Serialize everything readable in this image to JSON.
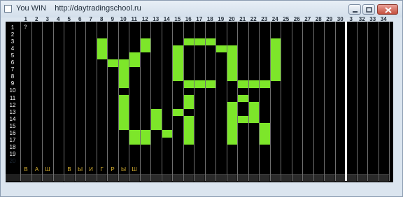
{
  "window": {
    "title": "You WIN    http://daytradingschool.ru",
    "controls": [
      "minimize",
      "maximize",
      "close"
    ]
  },
  "grid": {
    "columns": [
      "1",
      "2",
      "3",
      "4",
      "5",
      "6",
      "7",
      "8",
      "9",
      "10",
      "11",
      "12",
      "13",
      "14",
      "15",
      "16",
      "17",
      "18",
      "19",
      "20",
      "21",
      "22",
      "23",
      "24",
      "25",
      "26",
      "27",
      "28",
      "29",
      "30",
      "3",
      "32",
      "33",
      "34"
    ],
    "rows": [
      "1",
      "2",
      "3",
      "4",
      "5",
      "6",
      "7",
      "8",
      "9",
      "10",
      "11",
      "12",
      "13",
      "14",
      "15",
      "16",
      "17",
      "18",
      "19",
      "20"
    ],
    "row1_col1_text": "?",
    "row19_letters": [
      {
        "col": 1,
        "text": "В"
      },
      {
        "col": 2,
        "text": "А"
      },
      {
        "col": 3,
        "text": "Ш"
      },
      {
        "col": 5,
        "text": "В"
      },
      {
        "col": 6,
        "text": "Ы"
      },
      {
        "col": 7,
        "text": "И"
      },
      {
        "col": 8,
        "text": "Г"
      },
      {
        "col": 9,
        "text": "Р"
      },
      {
        "col": 10,
        "text": "Ы"
      },
      {
        "col": 11,
        "text": "Ш"
      }
    ],
    "lit_cells": [
      [
        3,
        8
      ],
      [
        3,
        12
      ],
      [
        3,
        16
      ],
      [
        3,
        17
      ],
      [
        3,
        18
      ],
      [
        3,
        24
      ],
      [
        4,
        8
      ],
      [
        4,
        12
      ],
      [
        4,
        15
      ],
      [
        4,
        19
      ],
      [
        4,
        20
      ],
      [
        4,
        24
      ],
      [
        5,
        8
      ],
      [
        5,
        11
      ],
      [
        5,
        15
      ],
      [
        5,
        20
      ],
      [
        5,
        24
      ],
      [
        6,
        9
      ],
      [
        6,
        10
      ],
      [
        6,
        11
      ],
      [
        6,
        15
      ],
      [
        6,
        20
      ],
      [
        6,
        24
      ],
      [
        7,
        10
      ],
      [
        7,
        15
      ],
      [
        7,
        20
      ],
      [
        7,
        24
      ],
      [
        8,
        10
      ],
      [
        8,
        15
      ],
      [
        8,
        20
      ],
      [
        8,
        24
      ],
      [
        9,
        10
      ],
      [
        9,
        16
      ],
      [
        9,
        17
      ],
      [
        9,
        18
      ],
      [
        9,
        21
      ],
      [
        9,
        22
      ],
      [
        9,
        23
      ],
      [
        11,
        10
      ],
      [
        11,
        16
      ],
      [
        11,
        21
      ],
      [
        12,
        10
      ],
      [
        12,
        16
      ],
      [
        12,
        20
      ],
      [
        12,
        22
      ],
      [
        13,
        10
      ],
      [
        13,
        13
      ],
      [
        13,
        15
      ],
      [
        13,
        20
      ],
      [
        13,
        22
      ],
      [
        14,
        10
      ],
      [
        14,
        13
      ],
      [
        14,
        16
      ],
      [
        14,
        20
      ],
      [
        14,
        21
      ],
      [
        14,
        22
      ],
      [
        15,
        10
      ],
      [
        15,
        13
      ],
      [
        15,
        16
      ],
      [
        15,
        20
      ],
      [
        15,
        23
      ],
      [
        16,
        11
      ],
      [
        16,
        12
      ],
      [
        16,
        14
      ],
      [
        16,
        16
      ],
      [
        16,
        20
      ],
      [
        16,
        23
      ],
      [
        17,
        11
      ],
      [
        17,
        12
      ],
      [
        17,
        16
      ],
      [
        17,
        20
      ],
      [
        17,
        23
      ]
    ],
    "lit_color": "#7de62a",
    "background_color": "#000000"
  }
}
